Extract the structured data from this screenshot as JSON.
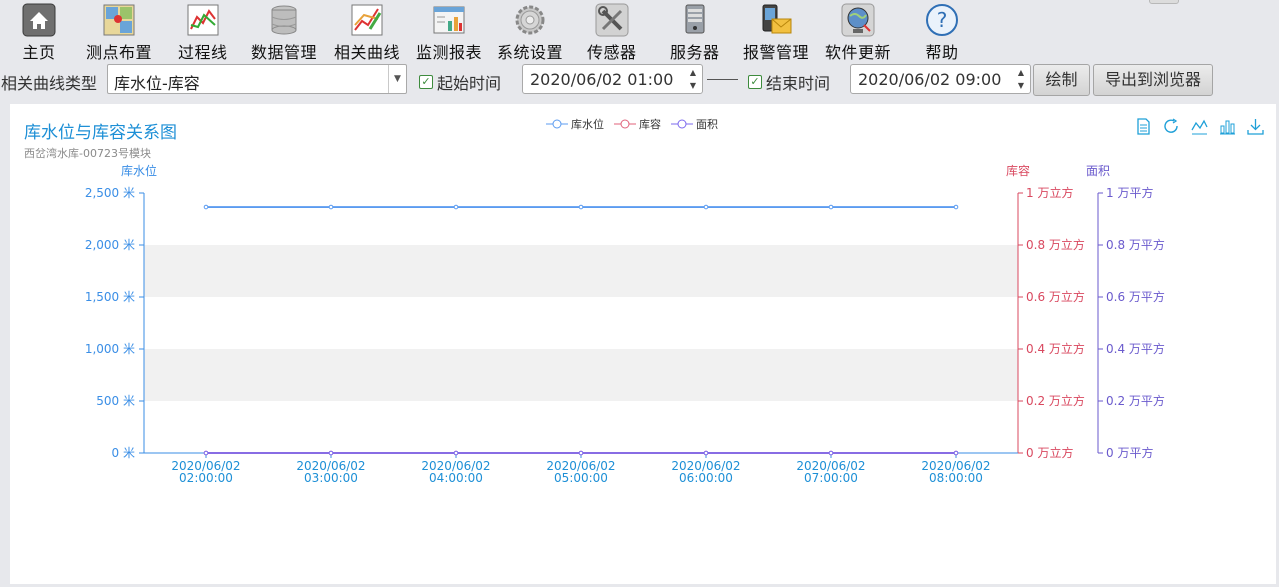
{
  "toolbar": {
    "items": [
      {
        "label": "主页",
        "icon": "home-icon"
      },
      {
        "label": "测点布置",
        "icon": "map-icon"
      },
      {
        "label": "过程线",
        "icon": "process-line-icon"
      },
      {
        "label": "数据管理",
        "icon": "database-icon"
      },
      {
        "label": "相关曲线",
        "icon": "correlation-curve-icon"
      },
      {
        "label": "监测报表",
        "icon": "report-icon"
      },
      {
        "label": "系统设置",
        "icon": "gear-icon"
      },
      {
        "label": "传感器",
        "icon": "tools-icon"
      },
      {
        "label": "服务器",
        "icon": "server-icon"
      },
      {
        "label": "报警管理",
        "icon": "alarm-mail-icon"
      },
      {
        "label": "软件更新",
        "icon": "update-globe-icon"
      },
      {
        "label": "帮助",
        "icon": "help-icon"
      }
    ]
  },
  "filter": {
    "type_label": "相关曲线类型",
    "type_value": "库水位-库容",
    "start_label": "起始时间",
    "start_value": "2020/06/02 01:00",
    "end_label": "结束时间",
    "end_value": "2020/06/02 09:00",
    "draw_button": "绘制",
    "export_button": "导出到浏览器"
  },
  "chart_data": {
    "type": "line",
    "title": "库水位与库容关系图",
    "subtitle": "西岔湾水库-00723号模块",
    "legend_position": "top-center",
    "grid": "alternating-bands",
    "x": [
      "2020/06/02 02:00:00",
      "2020/06/02 03:00:00",
      "2020/06/02 04:00:00",
      "2020/06/02 05:00:00",
      "2020/06/02 06:00:00",
      "2020/06/02 07:00:00",
      "2020/06/02 08:00:00"
    ],
    "axes": {
      "left": {
        "name": "库水位",
        "unit": "米",
        "min": 0,
        "max": 2500,
        "ticks": [
          0,
          500,
          1000,
          1500,
          2000,
          2500
        ],
        "tick_labels": [
          "0 米",
          "500 米",
          "1,000 米",
          "1,500 米",
          "2,000 米",
          "2,500 米"
        ],
        "color": "#3a8ee6"
      },
      "right1": {
        "name": "库容",
        "unit": "万立方",
        "min": 0,
        "max": 1,
        "ticks": [
          0,
          0.2,
          0.4,
          0.6,
          0.8,
          1
        ],
        "tick_labels": [
          "0 万立方",
          "0.2 万立方",
          "0.4 万立方",
          "0.6 万立方",
          "0.8 万立方",
          "1 万立方"
        ],
        "color": "#d9485f"
      },
      "right2": {
        "name": "面积",
        "unit": "万平方",
        "min": 0,
        "max": 1,
        "ticks": [
          0,
          0.2,
          0.4,
          0.6,
          0.8,
          1
        ],
        "tick_labels": [
          "0 万平方",
          "0.2 万平方",
          "0.4 万平方",
          "0.6 万平方",
          "0.8 万平方",
          "1 万平方"
        ],
        "color": "#6a5acd"
      }
    },
    "series": [
      {
        "name": "库水位",
        "axis": "left",
        "color": "#5b9bf0",
        "values": [
          2365,
          2365,
          2365,
          2365,
          2365,
          2365,
          2365
        ]
      },
      {
        "name": "库容",
        "axis": "right1",
        "color": "#e0627a",
        "values": [
          0,
          0,
          0,
          0,
          0,
          0,
          0
        ]
      },
      {
        "name": "面积",
        "axis": "right2",
        "color": "#7b68ee",
        "values": [
          0,
          0,
          0,
          0,
          0,
          0,
          0
        ]
      }
    ]
  },
  "chart_tools": [
    "data-view-icon",
    "refresh-icon",
    "line-chart-icon",
    "bar-chart-icon",
    "download-icon"
  ]
}
